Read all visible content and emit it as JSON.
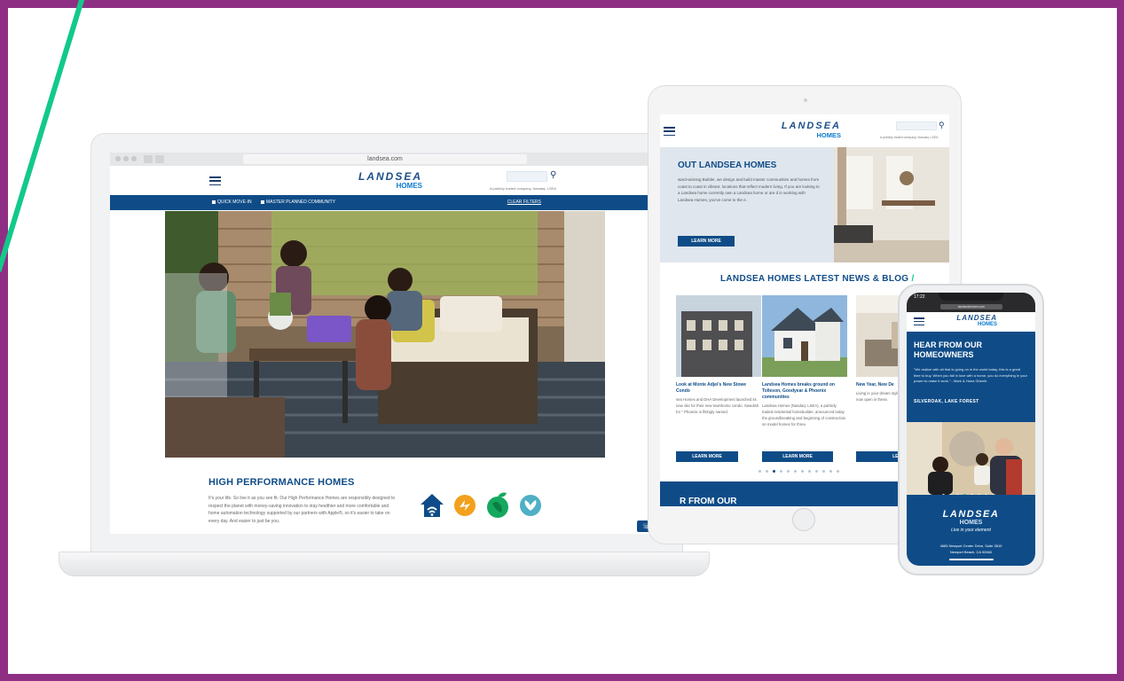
{
  "colors": {
    "frame": "#8e2f84",
    "accent_green": "#12c98a",
    "brand_blue": "#0f4c87"
  },
  "laptop": {
    "browser_url": "landsea.com",
    "logo_main": "LANDSEA",
    "logo_sub": "HOMES",
    "tagline": "A publicly traded company, Nasdaq: LSEA",
    "filters": [
      "QUICK MOVE-IN",
      "MASTER PLANNED COMMUNITY"
    ],
    "clear_filters": "CLEAR FILTERS",
    "section_title": "HIGH PERFORMANCE HOMES",
    "section_body": "It's your life. So live it as you see fit. Our High Performance Homes are responsibly designed to respect the planet with money-saving innovation to stay healthier and more comfortable and home automation technology supported by our partners with Apple®, so it's easier to take on every day. And easier to just be you.",
    "feature_icons": [
      "smart-home-icon",
      "energy-icon",
      "earth-leaf-icon",
      "wellness-icon"
    ],
    "phone_icon": "phone-icon"
  },
  "tablet": {
    "logo_main": "LANDSEA",
    "logo_sub": "HOMES",
    "tagline": "A publicly traded company, Nasdaq: LSEA",
    "about_title": "OUT LANDSEA HOMES",
    "about_body": "ward-winning Builder, we design and build master communities and homes from coast to coast in vibrant, locations that reflect modern living. If you are looking to a Landsea home currently own a Landsea home or are d in working with Landsea Homes, you've come to the e.",
    "about_button": "LEARN MORE",
    "news_title": "LANDSEA HOMES LATEST NEWS & BLOG",
    "news_slash": "/",
    "news": [
      {
        "title": "Look at Monte Adjei's New Stowe Condo",
        "body": "sea Homes and DHA Development launched its new site for their new townhome condo. Swedish for '' Phoenix is fittingly named.",
        "button": "LEARN MORE"
      },
      {
        "title": "Landsea Homes breaks ground on Tolleson, Goodyear & Phoenix communities",
        "body": "Landsea Homes (Nasdaq: LSEA), a publicly traded residential homebuilder, announced today the groundbreaking and beginning of construction on model homes for three.",
        "button": "LEARN MORE"
      },
      {
        "title": "New Year, New De",
        "body": "Living in your dream style with our brand center now open in these.",
        "button": "LEARN M"
      }
    ],
    "bottom_title": "R FROM OUR"
  },
  "phone": {
    "time": "17:22",
    "url": "landseahomes.com",
    "logo_main": "LANDSEA",
    "logo_sub": "HOMES",
    "heading": "HEAR FROM OUR HOMEOWNERS",
    "quote": "\"We realize with all that is going on in the world today, this is a great time to buy. When you fall in love with a home, you do everything in your power to make it work.\" - Mark & Hana Ghenib",
    "location": "SILVEROAK, LAKE FOREST",
    "footer_logo_main": "LANDSEA",
    "footer_logo_sub": "HOMES",
    "footer_tag": "Live in your element",
    "footer_address_1": "4665 Newport Center Drive, Suite 3810",
    "footer_address_2": "Newport Beach, CA 92660"
  }
}
